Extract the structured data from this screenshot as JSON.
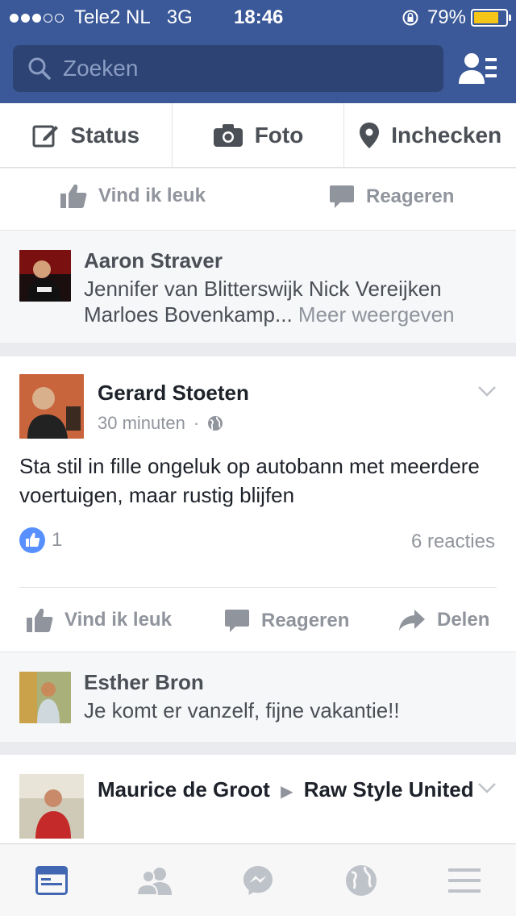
{
  "status_bar": {
    "carrier": "Tele2 NL",
    "network": "3G",
    "time": "18:46",
    "battery_percent": "79%",
    "battery_level": 0.79,
    "signal_bars": 3,
    "signal_total": 5
  },
  "search": {
    "placeholder": "Zoeken"
  },
  "composer": {
    "status_label": "Status",
    "photo_label": "Foto",
    "checkin_label": "Inchecken"
  },
  "previous_post": {
    "like_label": "Vind ik leuk",
    "comment_label": "Reageren",
    "comment": {
      "author": "Aaron Straver",
      "text": "Jennifer van Blitterswijk Nick Vereijken Marloes Bovenkamp...",
      "more": "Meer weergeven"
    }
  },
  "post": {
    "author": "Gerard Stoeten",
    "time": "30 minuten",
    "separator": "·",
    "body": "Sta stil in fille ongeluk op autobann met meerdere voertuigen, maar rustig blijfen",
    "like_count": "1",
    "comment_count": "6 reacties",
    "like_label": "Vind ik leuk",
    "comment_label": "Reageren",
    "share_label": "Delen",
    "comment": {
      "author": "Esther Bron",
      "text": "Je komt er vanzelf, fijne vakantie!!"
    }
  },
  "next_post": {
    "author": "Maurice de Groot",
    "arrow": "▶",
    "target": "Raw Style United"
  },
  "colors": {
    "brand": "#3b5998",
    "search_bg": "#2d4373",
    "like_blue": "#5890ff",
    "battery": "#f5c518"
  },
  "tabs": [
    "news-feed-icon",
    "friends-icon",
    "messenger-icon",
    "notifications-globe-icon",
    "menu-icon"
  ]
}
